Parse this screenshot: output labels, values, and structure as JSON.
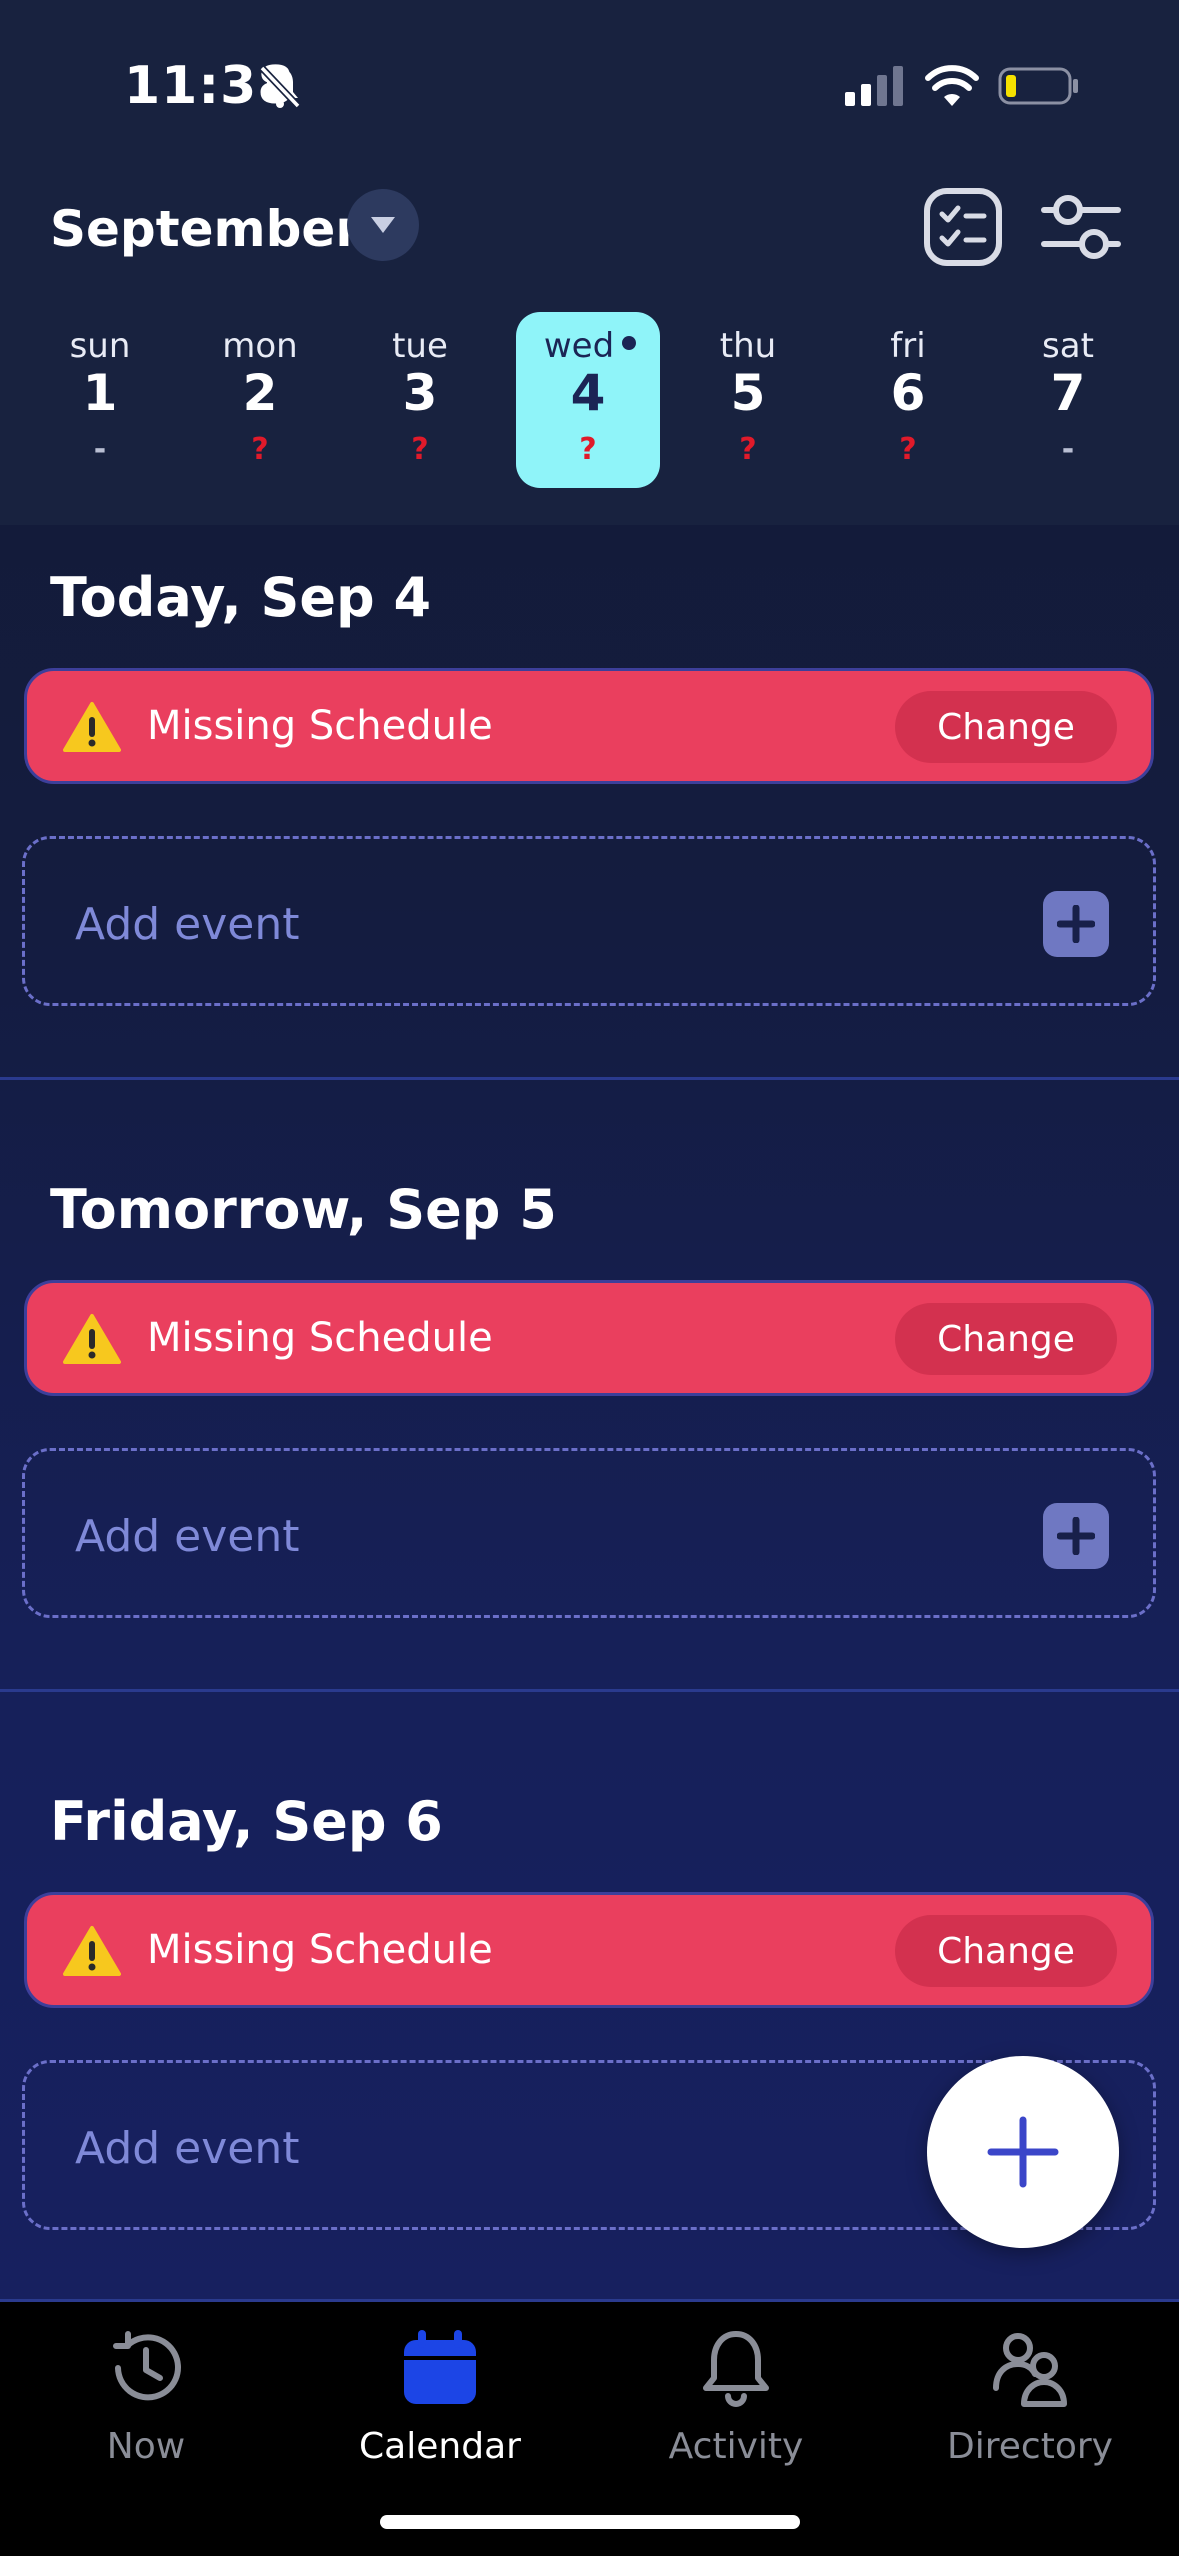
{
  "status": {
    "time": "11:38"
  },
  "header": {
    "month": "September",
    "week": [
      {
        "name": "sun",
        "num": "1",
        "mark": "-",
        "type": "dash",
        "selected": false
      },
      {
        "name": "mon",
        "num": "2",
        "mark": "?",
        "type": "q",
        "selected": false
      },
      {
        "name": "tue",
        "num": "3",
        "mark": "?",
        "type": "q",
        "selected": false
      },
      {
        "name": "wed",
        "num": "4",
        "mark": "?",
        "type": "q",
        "selected": true
      },
      {
        "name": "thu",
        "num": "5",
        "mark": "?",
        "type": "q",
        "selected": false
      },
      {
        "name": "fri",
        "num": "6",
        "mark": "?",
        "type": "q",
        "selected": false
      },
      {
        "name": "sat",
        "num": "7",
        "mark": "-",
        "type": "dash",
        "selected": false
      }
    ]
  },
  "sections": [
    {
      "title": "Today, Sep 4",
      "alert": "Missing Schedule",
      "change": "Change",
      "add": "Add event"
    },
    {
      "title": "Tomorrow, Sep 5",
      "alert": "Missing Schedule",
      "change": "Change",
      "add": "Add event"
    },
    {
      "title": "Friday, Sep 6",
      "alert": "Missing Schedule",
      "change": "Change",
      "add": "Add event"
    }
  ],
  "tabs": [
    {
      "label": "Now",
      "icon": "clock-icon"
    },
    {
      "label": "Calendar",
      "icon": "calendar-icon"
    },
    {
      "label": "Activity",
      "icon": "bell-icon"
    },
    {
      "label": "Directory",
      "icon": "people-icon"
    }
  ],
  "colors": {
    "alert": "#ea3f5e",
    "selected_day": "#8ff4f9",
    "accent_blue": "#1c45e6",
    "dashed_border": "#6b6fc9"
  }
}
